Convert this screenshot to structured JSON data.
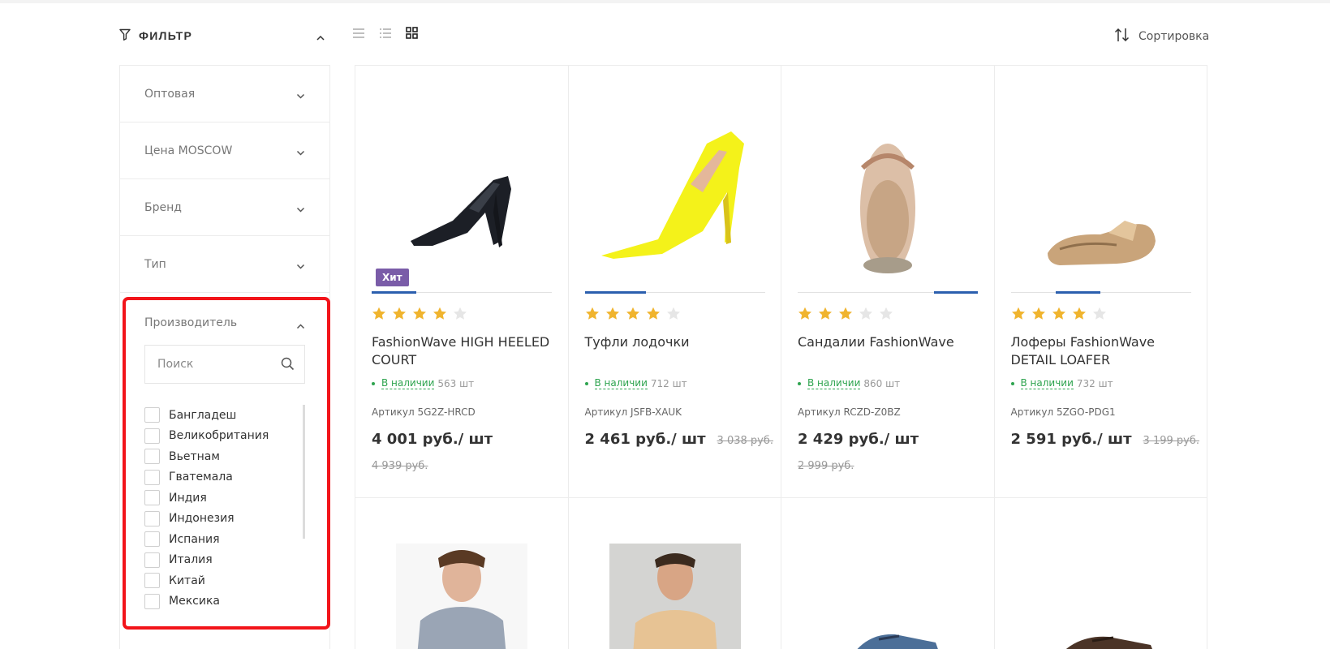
{
  "filter": {
    "title": "ФИЛЬТР",
    "sections": [
      {
        "label": "Оптовая"
      },
      {
        "label": "Цена MOSCOW"
      },
      {
        "label": "Бренд"
      },
      {
        "label": "Тип"
      }
    ],
    "manufacturer": {
      "label": "Производитель",
      "search_placeholder": "Поиск",
      "countries": [
        "Бангладеш",
        "Великобритания",
        "Вьетнам",
        "Гватемала",
        "Индия",
        "Индонезия",
        "Испания",
        "Италия",
        "Китай",
        "Мексика"
      ]
    }
  },
  "toolbar": {
    "sort_label": "Сортировка",
    "active_view": "grid"
  },
  "colors": {
    "accent_blue": "#2b5fae",
    "in_stock_green": "#2ea44f",
    "star_gold": "#f0b42e",
    "badge_purple": "#7a5ca8",
    "highlight_red": "#f2141a"
  },
  "products": [
    {
      "name": "FashionWave HIGH HEELED COURT",
      "badge": "Хит",
      "rating": 4,
      "stock_label": "В наличии",
      "stock_qty": "563 шт",
      "sku": "Артикул 5G2Z-HRCD",
      "price": "4 001 руб./ шт",
      "old_price": "4 939 руб.",
      "image_icon": "black-pump-shoe"
    },
    {
      "name": "Туфли лодочки",
      "badge": "",
      "rating": 4,
      "stock_label": "В наличии",
      "stock_qty": "712 шт",
      "sku": "Артикул JSFB-XAUK",
      "price": "2 461 руб./ шт",
      "old_price": "3 038 руб.",
      "image_icon": "yellow-pump-shoe"
    },
    {
      "name": "Сандалии FashionWave",
      "badge": "",
      "rating": 3,
      "stock_label": "В наличии",
      "stock_qty": "860 шт",
      "sku": "Артикул RCZD-Z0BZ",
      "price": "2 429 руб./ шт",
      "old_price": "2 999 руб.",
      "image_icon": "sandal"
    },
    {
      "name": "Лоферы FashionWave DETAIL LOAFER",
      "badge": "",
      "rating": 4,
      "stock_label": "В наличии",
      "stock_qty": "732 шт",
      "sku": "Артикул 5ZGO-PDG1",
      "price": "2 591 руб./ шт",
      "old_price": "3 199 руб.",
      "image_icon": "gold-loafer"
    }
  ],
  "products_row2": [
    {
      "image_icon": "man-shirt"
    },
    {
      "image_icon": "man-tshirt"
    },
    {
      "image_icon": "blue-shoe"
    },
    {
      "image_icon": "brown-shoe"
    }
  ]
}
